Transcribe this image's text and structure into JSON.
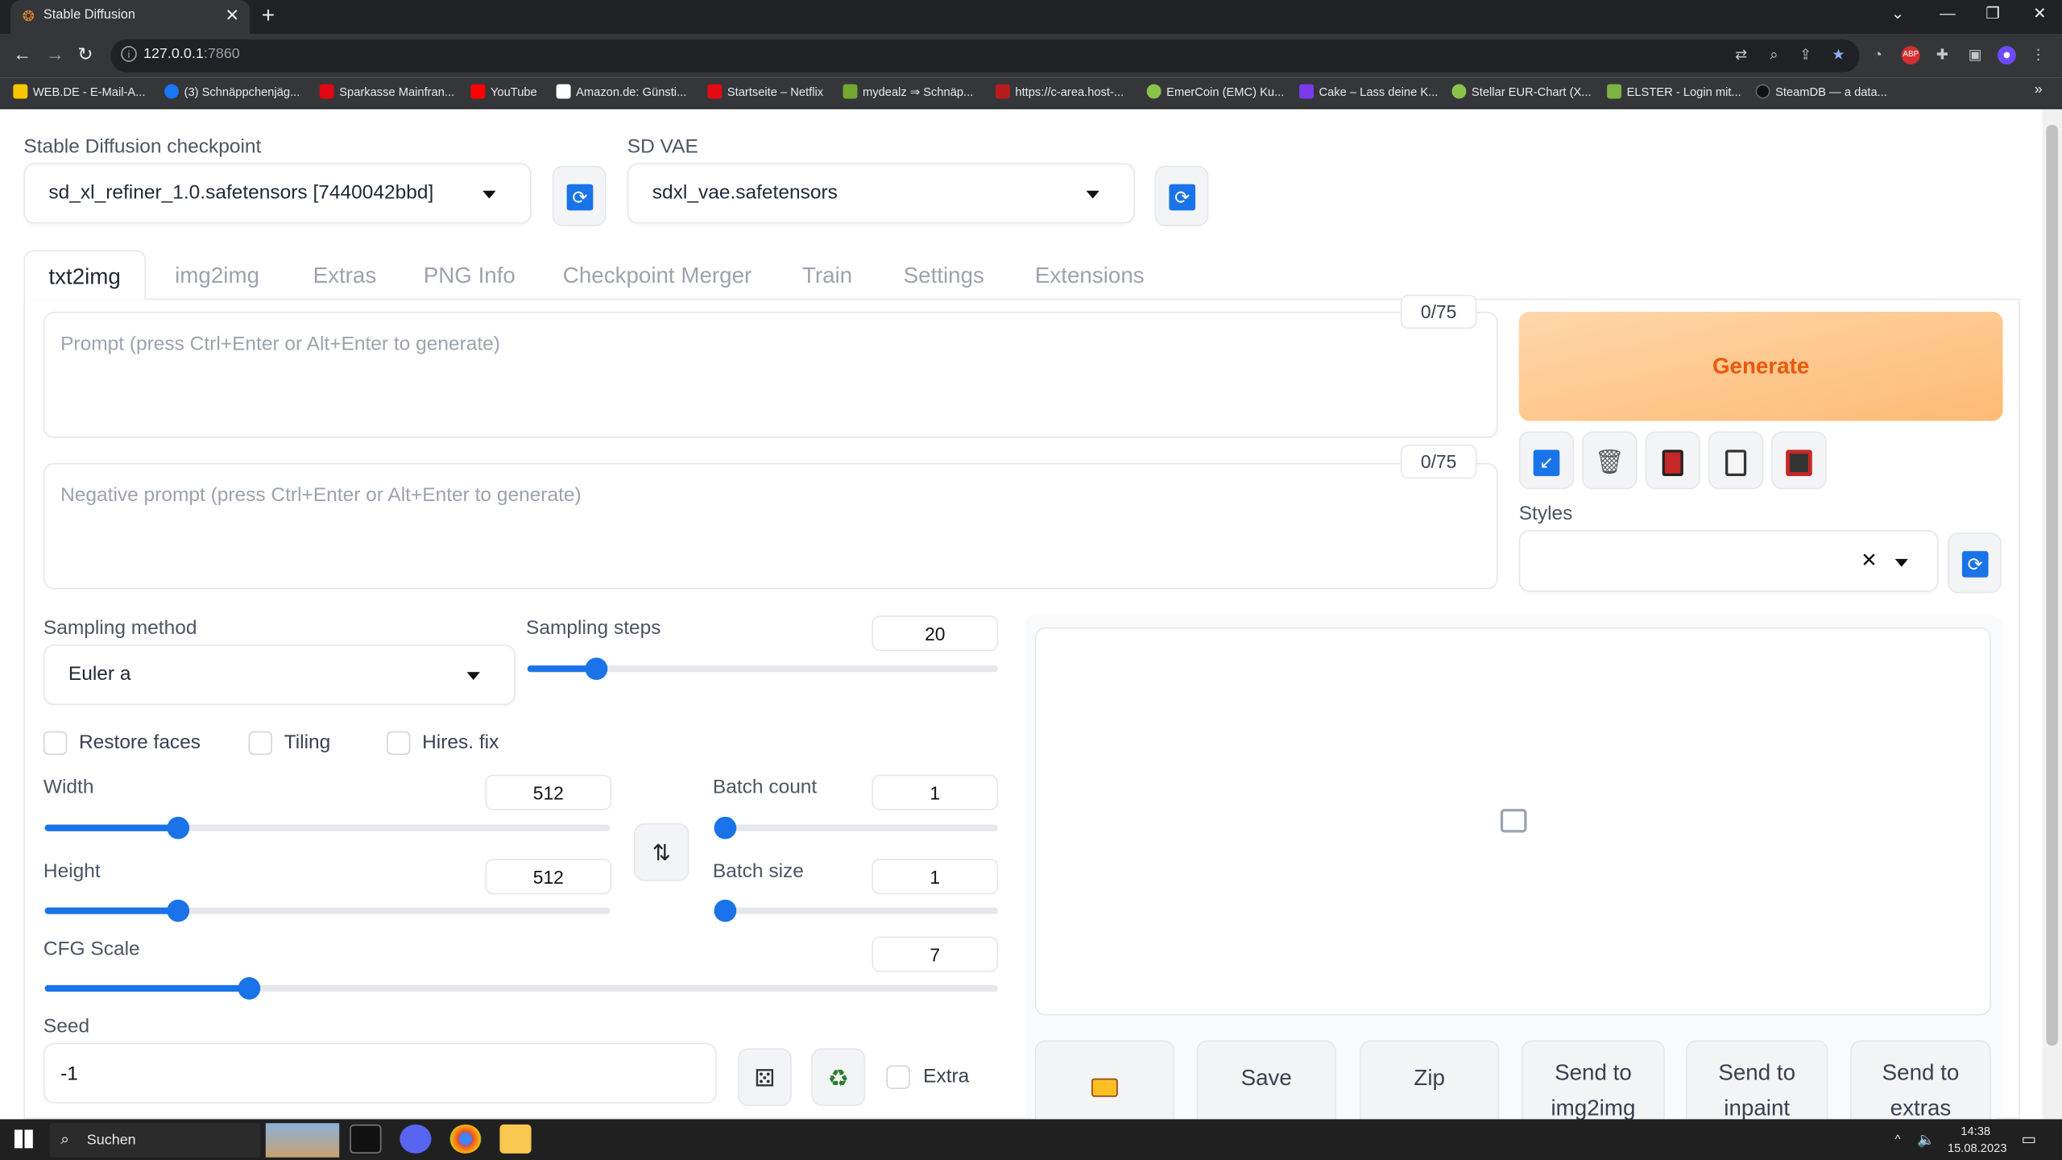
{
  "browser": {
    "tab_title": "Stable Diffusion",
    "url_host": "127.0.0.1",
    "url_port": ":7860",
    "bookmarks": [
      {
        "label": "WEB.DE - E-Mail-A...",
        "color": "#f7c600"
      },
      {
        "label": "(3) Schnäppchenjäg...",
        "color": "#1877f2"
      },
      {
        "label": "Sparkasse Mainfran...",
        "color": "#e30613"
      },
      {
        "label": "YouTube",
        "color": "#ff0000"
      },
      {
        "label": "Amazon.de: Günsti...",
        "color": "#ffffff"
      },
      {
        "label": "Startseite – Netflix",
        "color": "#e50914"
      },
      {
        "label": "mydealz ⇒ Schnäp...",
        "color": "#73a930"
      },
      {
        "label": "https://c-area.host-...",
        "color": "#b71c1c"
      },
      {
        "label": "EmerCoin (EMC) Ku...",
        "color": "#8bc34a"
      },
      {
        "label": "Cake – Lass deine K...",
        "color": "#7c3aed"
      },
      {
        "label": "Stellar EUR-Chart (X...",
        "color": "#8bc34a"
      },
      {
        "label": "ELSTER - Login mit...",
        "color": "#7cb342"
      },
      {
        "label": "SteamDB — a data...",
        "color": "#111111"
      }
    ]
  },
  "header": {
    "checkpoint_label": "Stable Diffusion checkpoint",
    "checkpoint_value": "sd_xl_refiner_1.0.safetensors [7440042bbd]",
    "vae_label": "SD VAE",
    "vae_value": "sdxl_vae.safetensors"
  },
  "tabs": [
    "txt2img",
    "img2img",
    "Extras",
    "PNG Info",
    "Checkpoint Merger",
    "Train",
    "Settings",
    "Extensions"
  ],
  "prompt": {
    "placeholder": "Prompt (press Ctrl+Enter or Alt+Enter to generate)",
    "counter": "0/75",
    "neg_placeholder": "Negative prompt (press Ctrl+Enter or Alt+Enter to generate)",
    "neg_counter": "0/75"
  },
  "actions": {
    "generate": "Generate",
    "styles_label": "Styles"
  },
  "params": {
    "sampling_method_label": "Sampling method",
    "sampling_method_value": "Euler a",
    "sampling_steps_label": "Sampling steps",
    "sampling_steps_value": "20",
    "sampling_steps_level": 0.13,
    "restore_faces": "Restore faces",
    "tiling": "Tiling",
    "hires_fix": "Hires. fix",
    "width_label": "Width",
    "width_value": "512",
    "height_label": "Height",
    "height_value": "512",
    "batch_count_label": "Batch count",
    "batch_count_value": "1",
    "batch_size_label": "Batch size",
    "batch_size_value": "1",
    "cfg_label": "CFG Scale",
    "cfg_value": "7",
    "seed_label": "Seed",
    "seed_value": "-1",
    "extra_label": "Extra"
  },
  "output_buttons": {
    "save": "Save",
    "zip": "Zip",
    "send_img2img_1": "Send to",
    "send_img2img_2": "img2img",
    "send_inpaint_1": "Send to",
    "send_inpaint_2": "inpaint",
    "send_extras_1": "Send to",
    "send_extras_2": "extras"
  },
  "taskbar": {
    "search": "Suchen",
    "time": "14:38",
    "date": "15.08.2023"
  }
}
